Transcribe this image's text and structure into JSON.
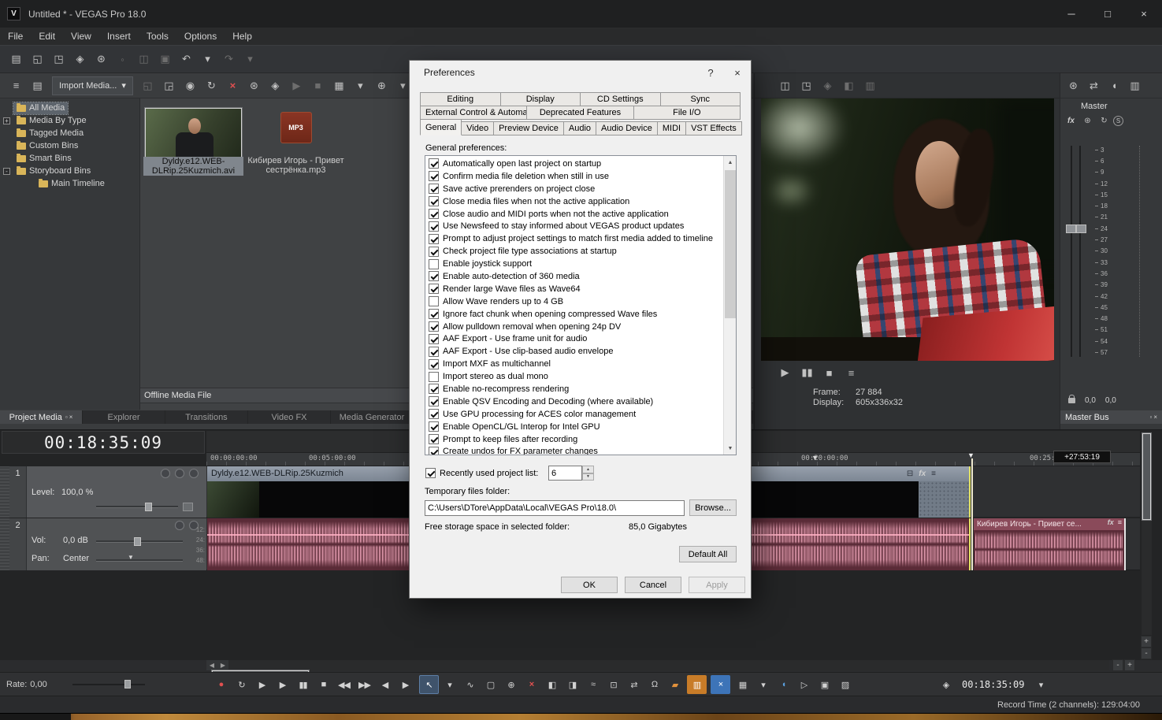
{
  "ui": {
    "float_icon": "▫",
    "close_icon": "×",
    "minimize_icon": "─",
    "maximize_icon": "□",
    "dropdown_icon": "▾",
    "spin_up": "▲",
    "spin_down": "▼",
    "scroll_left": "◀",
    "scroll_right": "▶",
    "zoom_in": "+",
    "zoom_out": "-",
    "help_icon": "?",
    "marker_down": "▼",
    "app_initial": "V"
  },
  "titlebar": {
    "title": "Untitled * - VEGAS Pro 18.0"
  },
  "menubar": {
    "items": [
      "File",
      "Edit",
      "View",
      "Insert",
      "Tools",
      "Options",
      "Help"
    ]
  },
  "main_toolbar": [
    {
      "name": "new-project-icon",
      "glyph": "▤"
    },
    {
      "name": "open-project-icon",
      "glyph": "◱"
    },
    {
      "name": "save-project-icon",
      "glyph": "◳"
    },
    {
      "name": "render-as-icon",
      "glyph": "◈"
    },
    {
      "name": "project-properties-icon",
      "glyph": "⊛"
    },
    {
      "name": "cut-icon",
      "glyph": "◦",
      "dim": true
    },
    {
      "name": "copy-icon",
      "glyph": "◫",
      "dim": true
    },
    {
      "name": "paste-icon",
      "glyph": "▣",
      "dim": true
    },
    {
      "name": "undo-icon",
      "glyph": "↶"
    },
    {
      "name": "undo-dropdown-icon",
      "glyph": "▾"
    },
    {
      "name": "redo-icon",
      "glyph": "↷",
      "dim": true
    },
    {
      "name": "redo-dropdown-icon",
      "glyph": "▾",
      "dim": true
    }
  ],
  "project_media": {
    "menu_icon": "≡",
    "bins_icon": "▤",
    "import_button": "Import Media...",
    "toolbar": [
      {
        "name": "open-media-icon",
        "glyph": "◱",
        "dim": true
      },
      {
        "name": "capture-video-icon",
        "glyph": "◲"
      },
      {
        "name": "extract-audio-icon",
        "glyph": "◉"
      },
      {
        "name": "refresh-media-icon",
        "glyph": "↻"
      },
      {
        "name": "remove-media-icon",
        "glyph": "×",
        "cls": "red-glyph"
      },
      {
        "name": "media-properties-icon",
        "glyph": "⊛"
      },
      {
        "name": "media-fx-icon",
        "glyph": "◈"
      },
      {
        "name": "start-preview-icon",
        "glyph": "▶",
        "dim": true
      },
      {
        "name": "stop-preview-icon",
        "glyph": "■",
        "dim": true
      },
      {
        "name": "views-icon",
        "glyph": "▦"
      },
      {
        "name": "views-dropdown-icon",
        "glyph": "▾"
      },
      {
        "name": "search-media-icon",
        "glyph": "⊕"
      },
      {
        "name": "search-dropdown-icon",
        "glyph": "▾"
      }
    ],
    "tree": [
      {
        "label": "All Media",
        "selected": true
      },
      {
        "label": "Media By Type",
        "exp": true,
        "expg": "+"
      },
      {
        "label": "Tagged Media"
      },
      {
        "label": "Custom Bins"
      },
      {
        "label": "Smart Bins"
      },
      {
        "label": "Storyboard Bins",
        "exp": true,
        "expg": "-"
      },
      {
        "label": "Main Timeline",
        "child": true
      }
    ],
    "video_item_label": "Dyldy.e12.WEB-DLRip.25Kuzmich.avi",
    "mp3_badge": "MP3",
    "mp3_item_label": "Кибирев Игорь - Привет сестрёнка.mp3",
    "status": "Offline Media File",
    "tabs": [
      {
        "label": "Project Media",
        "active": true
      },
      {
        "label": "Explorer"
      },
      {
        "label": "Transitions"
      },
      {
        "label": "Video FX"
      },
      {
        "label": "Media Generator"
      }
    ]
  },
  "preview": {
    "toolbar": [
      {
        "name": "copy-snapshot-icon",
        "glyph": "◫"
      },
      {
        "name": "save-snapshot-icon",
        "glyph": "◳"
      },
      {
        "name": "video-output-fx-icon",
        "glyph": "◈",
        "dim": true
      },
      {
        "name": "split-screen-view-icon",
        "glyph": "◧",
        "dim": true
      },
      {
        "name": "preview-quality-icon",
        "glyph": "▥",
        "dim": true
      }
    ],
    "transport": [
      {
        "name": "preview-play-button",
        "glyph": "▶"
      },
      {
        "name": "preview-pause-button",
        "glyph": "▮▮"
      },
      {
        "name": "preview-stop-button",
        "glyph": "■"
      },
      {
        "name": "preview-menu-button",
        "glyph": "≡"
      }
    ],
    "frame_label": "Frame:",
    "frame_value": "27 884",
    "display_label": "Display:",
    "display_value": "605x336x32"
  },
  "master": {
    "toolbar": [
      {
        "name": "insert-bus-icon",
        "glyph": "⊛"
      },
      {
        "name": "io-routing-icon",
        "glyph": "⇄"
      },
      {
        "name": "speaker-icon",
        "glyph": "◖"
      },
      {
        "name": "downmix-icon",
        "glyph": "▥"
      }
    ],
    "name": "Master",
    "fx_label": "fx",
    "fx_row": [
      {
        "name": "master-properties-icon",
        "glyph": "⊛"
      },
      {
        "name": "master-automation-icon",
        "glyph": "↻"
      }
    ],
    "solo_label": "S",
    "db_scale": [
      "3",
      "6",
      "9",
      "12",
      "15",
      "18",
      "21",
      "24",
      "27",
      "30",
      "33",
      "36",
      "39",
      "42",
      "45",
      "48",
      "51",
      "54",
      "57"
    ],
    "left_value": "0,0",
    "right_value": "0,0",
    "tab": "Master Bus"
  },
  "timeline": {
    "time_display": "00:18:35:09",
    "ruler_marks": [
      {
        "label": "00:00:00:00"
      },
      {
        "label": "00:05:00:00"
      },
      {
        "label": "00:20:00:00"
      },
      {
        "label": "00:25:00:00"
      }
    ],
    "cursor_badge": "+27:53:19",
    "track1": {
      "number": "1",
      "level_label": "Level:",
      "level_value": "100,0 %",
      "clip_label": "Dyldy.e12.WEB-DLRip.25Kuzmich",
      "clip_fx_label": "fx"
    },
    "track2": {
      "number": "2",
      "vol_label": "Vol:",
      "vol_value": "0,0 dB",
      "pan_label": "Pan:",
      "pan_value": "Center",
      "clip_label": "Кибирев Игорь - Привет се...",
      "clip_fx_label": "fx",
      "tick_labels": [
        "12:",
        "24:",
        "36:",
        "48:"
      ]
    }
  },
  "transport": {
    "rate_label": "Rate:",
    "rate_value": "0,00",
    "buttons": [
      {
        "name": "record-button",
        "glyph": "●",
        "cls": "red-glyph"
      },
      {
        "name": "loop-playback-button",
        "glyph": "↻"
      },
      {
        "name": "play-from-start-button",
        "glyph": "▶"
      },
      {
        "name": "play-button",
        "glyph": "▶"
      },
      {
        "name": "pause-button",
        "glyph": "▮▮"
      },
      {
        "name": "stop-button",
        "glyph": "■"
      },
      {
        "name": "go-to-start-button",
        "glyph": "◀◀"
      },
      {
        "name": "go-to-end-button",
        "glyph": "▶▶"
      },
      {
        "name": "previous-frame-button",
        "glyph": "◀"
      },
      {
        "name": "next-frame-button",
        "glyph": "▶"
      }
    ],
    "tools": [
      {
        "name": "normal-edit-tool-button",
        "glyph": "↖",
        "cls": "active-tool"
      },
      {
        "name": "edit-tool-dropdown-icon",
        "glyph": "▾"
      },
      {
        "name": "envelope-edit-tool-button",
        "glyph": "∿"
      },
      {
        "name": "selection-edit-tool-button",
        "glyph": "▢"
      },
      {
        "name": "zoom-edit-tool-button",
        "glyph": "⊕"
      },
      {
        "name": "split-button",
        "glyph": "×",
        "cls": "red-glyph"
      },
      {
        "name": "trim-start-button",
        "glyph": "◧"
      },
      {
        "name": "trim-end-button",
        "glyph": "◨"
      },
      {
        "name": "post-edit-ripple-button",
        "glyph": "≈"
      },
      {
        "name": "lock-envelopes-button",
        "glyph": "⊡"
      },
      {
        "name": "auto-ripple-button",
        "glyph": "⇄"
      },
      {
        "name": "snapping-button",
        "glyph": "Ω"
      },
      {
        "name": "insert-marker-button",
        "glyph": "▰",
        "cls": "orange"
      },
      {
        "name": "record-input-meters-button",
        "glyph": "▥",
        "cls": "orange-bg"
      },
      {
        "name": "mute-all-audio-button",
        "glyph": "×",
        "cls": "blue-bg"
      },
      {
        "name": "mixer-button",
        "glyph": "▦"
      },
      {
        "name": "mixer-dropdown-icon",
        "glyph": "▾"
      },
      {
        "name": "audio-output-button",
        "glyph": "◖",
        "cls": "blue"
      },
      {
        "name": "video-output-button",
        "glyph": "▷"
      },
      {
        "name": "external-monitor-button",
        "glyph": "▣"
      },
      {
        "name": "open-explorer-button",
        "glyph": "▨"
      }
    ],
    "pin_icon": "◈",
    "time_display": "00:18:35:09"
  },
  "statusbar": {
    "record_time": "Record Time (2 channels): 129:04:00"
  },
  "preferences": {
    "title": "Preferences",
    "tabs_row1": [
      "Editing",
      "Display",
      "CD Settings",
      "Sync"
    ],
    "tabs_row2": [
      "External Control & Automation",
      "Deprecated Features",
      "File I/O"
    ],
    "tabs_row3": [
      {
        "label": "General",
        "active": true
      },
      {
        "label": "Video"
      },
      {
        "label": "Preview Device"
      },
      {
        "label": "Audio"
      },
      {
        "label": "Audio Device"
      },
      {
        "label": "MIDI"
      },
      {
        "label": "VST Effects"
      }
    ],
    "section_label": "General preferences:",
    "options": [
      {
        "label": "Automatically open last project on startup",
        "checked": true
      },
      {
        "label": "Confirm media file deletion when still in use",
        "checked": true
      },
      {
        "label": "Save active prerenders on project close",
        "checked": true
      },
      {
        "label": "Close media files when not the active application",
        "checked": true
      },
      {
        "label": "Close audio and MIDI ports when not the active application",
        "checked": true
      },
      {
        "label": "Use Newsfeed to stay informed about VEGAS product updates",
        "checked": true
      },
      {
        "label": "Prompt to adjust project settings to match first media added to timeline",
        "checked": true
      },
      {
        "label": "Check project file type associations at startup",
        "checked": true
      },
      {
        "label": "Enable joystick support",
        "checked": false
      },
      {
        "label": "Enable auto-detection of 360 media",
        "checked": true
      },
      {
        "label": "Render large Wave files as Wave64",
        "checked": true
      },
      {
        "label": "Allow Wave renders up to 4 GB",
        "checked": false
      },
      {
        "label": "Ignore fact chunk when opening compressed Wave files",
        "checked": true
      },
      {
        "label": "Allow pulldown removal when opening 24p DV",
        "checked": true
      },
      {
        "label": "AAF Export - Use frame unit for audio",
        "checked": true
      },
      {
        "label": "AAF Export - Use clip-based audio envelope",
        "checked": true
      },
      {
        "label": "Import MXF as multichannel",
        "checked": true
      },
      {
        "label": "Import stereo as dual mono",
        "checked": false
      },
      {
        "label": "Enable no-recompress rendering",
        "checked": true
      },
      {
        "label": "Enable QSV Encoding and Decoding (where available)",
        "checked": true
      },
      {
        "label": "Use GPU processing for ACES color management",
        "checked": true
      },
      {
        "label": "Enable OpenCL/GL Interop for Intel GPU",
        "checked": true
      },
      {
        "label": "Prompt to keep files after recording",
        "checked": true
      },
      {
        "label": "Create undos for FX parameter changes",
        "checked": true
      }
    ],
    "recent_checkbox_label": "Recently used project list:",
    "recent_value": "6",
    "temp_folder_label": "Temporary files folder:",
    "temp_folder_value": "C:\\Users\\DTore\\AppData\\Local\\VEGAS Pro\\18.0\\",
    "browse_button": "Browse...",
    "free_space_label": "Free storage space in selected folder:",
    "free_space_value": "85,0 Gigabytes",
    "default_all_button": "Default All",
    "ok_button": "OK",
    "cancel_button": "Cancel",
    "apply_button": "Apply"
  }
}
